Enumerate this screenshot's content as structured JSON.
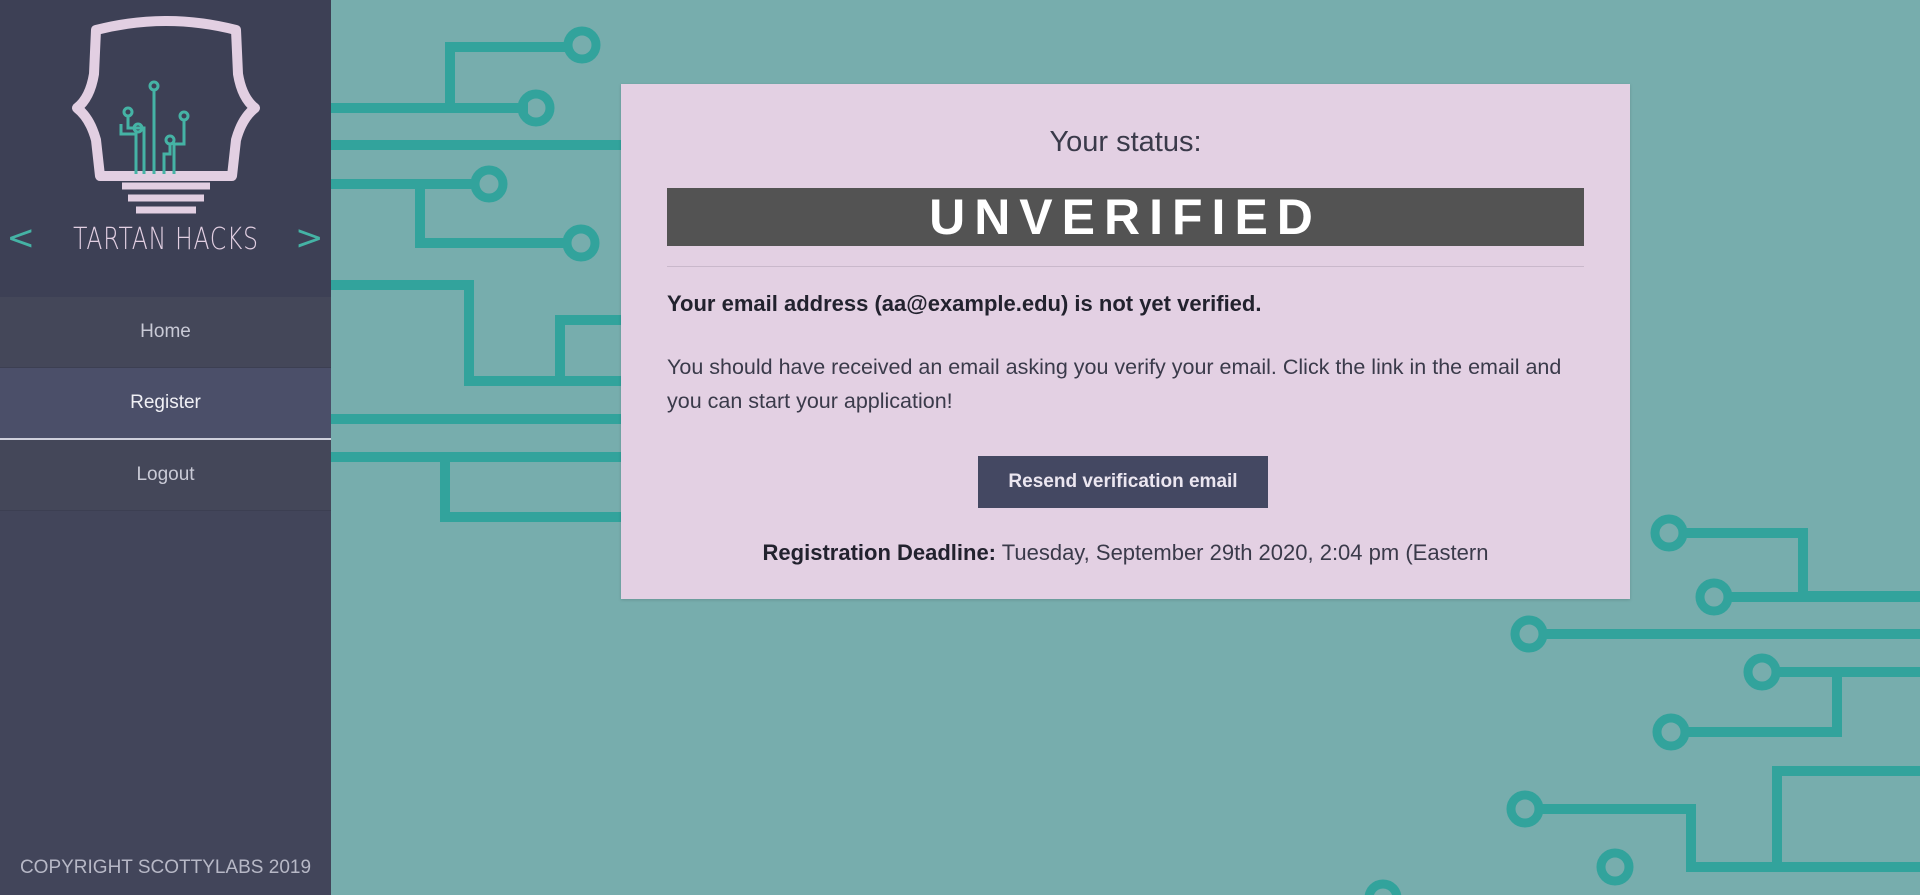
{
  "sidebar": {
    "brand": {
      "left_bracket": "<",
      "name": "TARTAN HACKS",
      "right_bracket": ">",
      "logo_icon": "lightbulb-circuit-icon"
    },
    "nav": [
      {
        "label": "Home",
        "active": false
      },
      {
        "label": "Register",
        "active": true
      },
      {
        "label": "Logout",
        "active": false
      }
    ],
    "copyright": "COPYRIGHT SCOTTYLABS 2019"
  },
  "card": {
    "title": "Your status:",
    "status": "UNVERIFIED",
    "warning": "Your email address (aa@example.edu) is not yet verified.",
    "body": "You should have received an email asking you verify your email. Click the link in the email and you can start your application!",
    "button_label": "Resend verification email",
    "deadline_label": "Registration Deadline:",
    "deadline_value": "Tuesday, September 29th 2020, 2:04 pm (Eastern"
  },
  "colors": {
    "background": "#77adad",
    "circuit": "#32a39c",
    "sidebar": "#42455a",
    "card": "#e3d0e3",
    "status_bar": "#535353",
    "button": "#444862",
    "accent": "#45b3a5"
  }
}
